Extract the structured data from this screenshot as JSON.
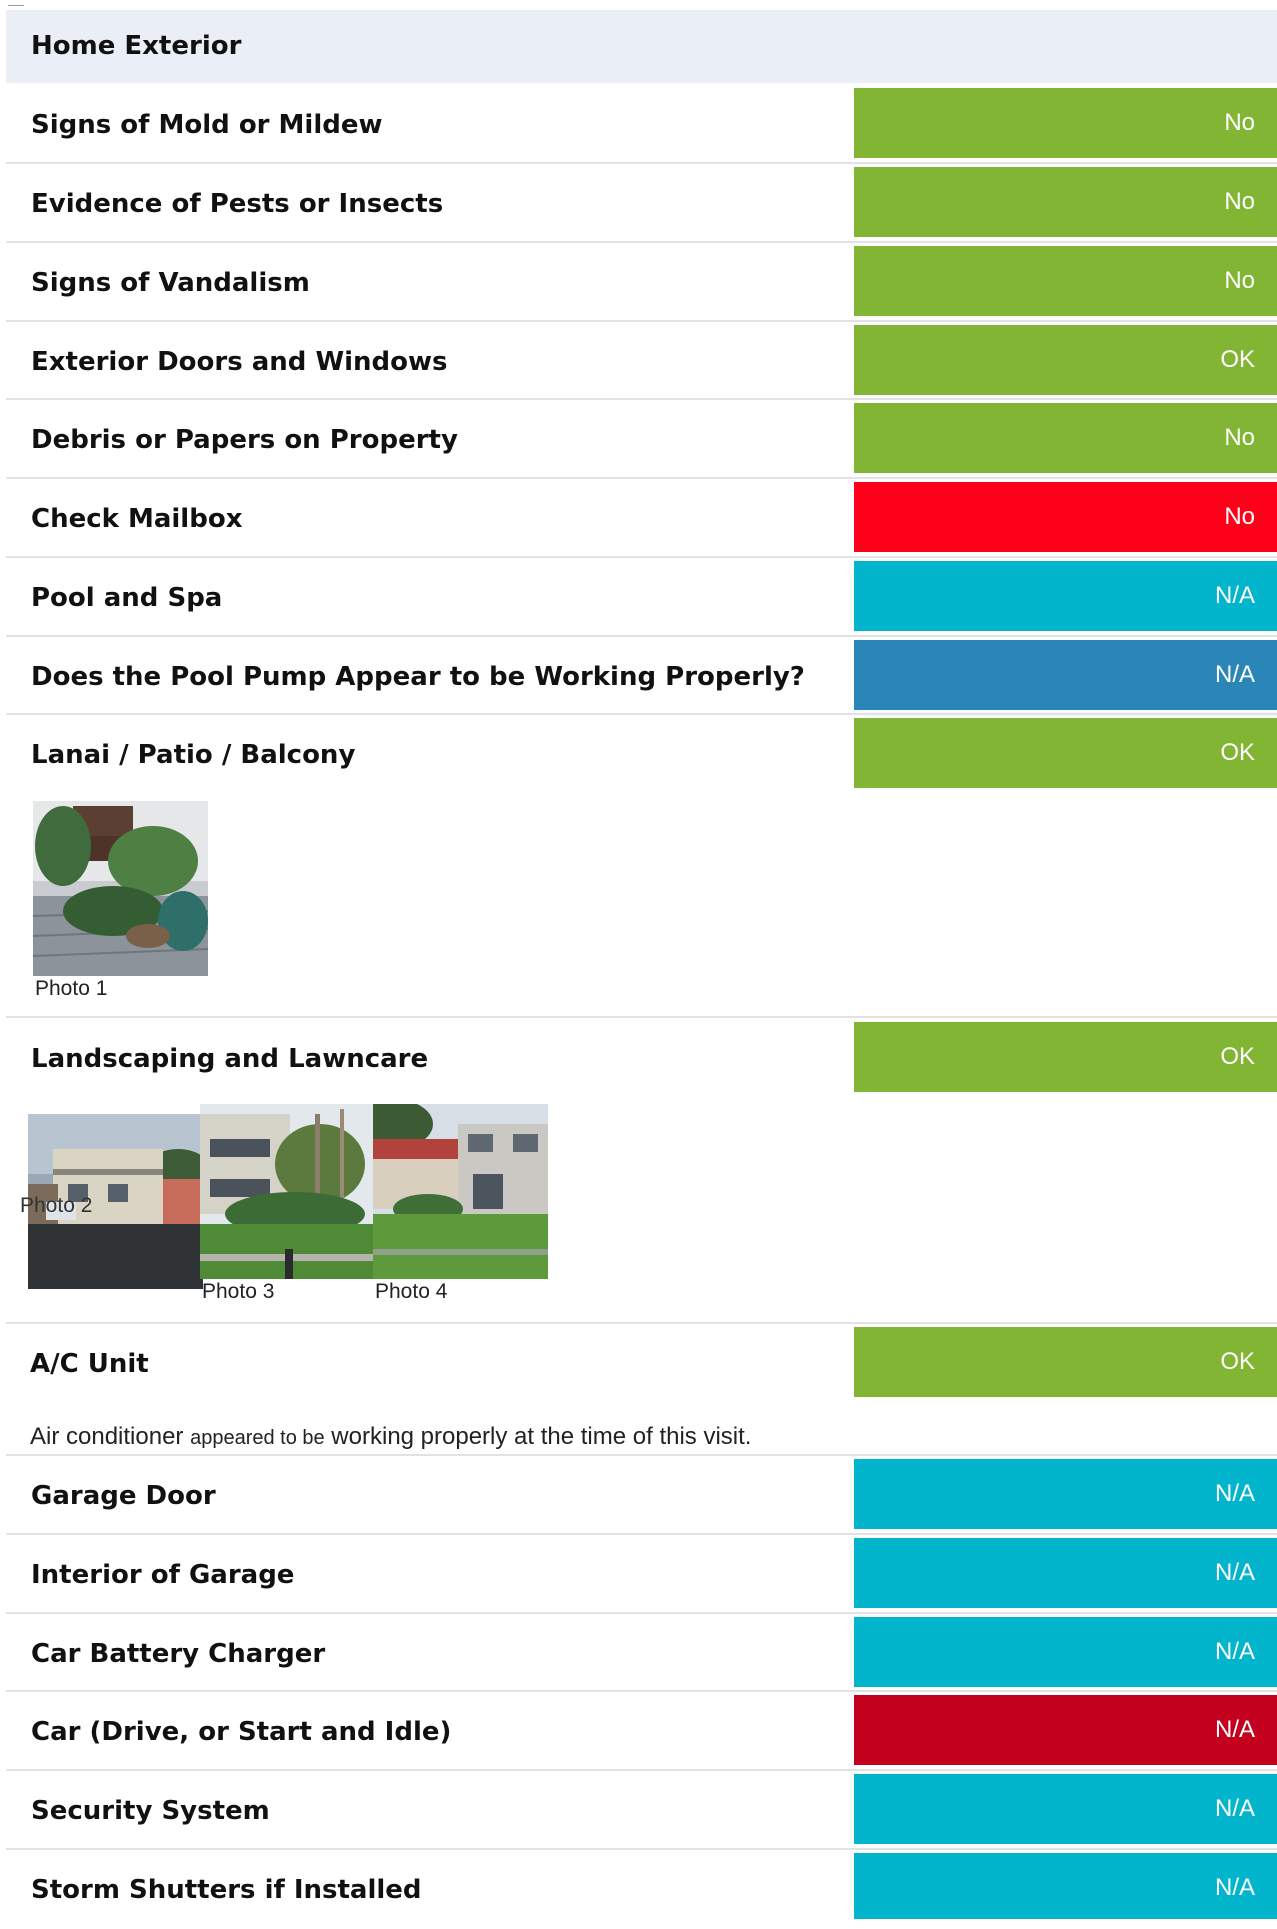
{
  "section": {
    "title": "Home Exterior"
  },
  "items": [
    {
      "label": "Signs of Mold or Mildew",
      "status": "No",
      "color": "#82b533"
    },
    {
      "label": "Evidence of Pests or Insects",
      "status": "No",
      "color": "#82b533"
    },
    {
      "label": "Signs of Vandalism",
      "status": "No",
      "color": "#82b533"
    },
    {
      "label": "Exterior Doors and Windows",
      "status": "OK",
      "color": "#82b533"
    },
    {
      "label": "Debris or Papers on Property",
      "status": "No",
      "color": "#82b533"
    },
    {
      "label": "Check Mailbox",
      "status": "No",
      "color": "#ff001b"
    },
    {
      "label": "Pool and Spa",
      "status": "N/A",
      "color": "#02b5cc"
    },
    {
      "label": "Does the Pool Pump Appear to be Working Properly?",
      "status": "N/A",
      "color": "#2b86b8"
    },
    {
      "label": "Lanai / Patio / Balcony",
      "status": "OK",
      "color": "#82b533",
      "photos": [
        {
          "caption": "Photo 1"
        }
      ]
    },
    {
      "label": "Landscaping and  Lawncare",
      "status": "OK",
      "color": "#82b533",
      "photos": [
        {
          "caption": "Photo 2"
        },
        {
          "caption": "Photo 3"
        },
        {
          "caption": "Photo 4"
        }
      ]
    },
    {
      "label": "A/C Unit",
      "status": "OK",
      "color": "#82b533",
      "note": {
        "part1": "Air conditioner ",
        "part2": "appeared  to  be",
        "part3": " working properly at the time of this visit."
      }
    },
    {
      "label": "Garage Door",
      "status": "N/A",
      "color": "#02b5cc"
    },
    {
      "label": "Interior of Garage",
      "status": "N/A",
      "color": "#02b5cc"
    },
    {
      "label": "Car Battery Charger",
      "status": "N/A",
      "color": "#02b5cc"
    },
    {
      "label": "Car (Drive, or Start and Idle)",
      "status": "N/A",
      "color": "#c4001f"
    },
    {
      "label": "Security System",
      "status": "N/A",
      "color": "#02b5cc"
    },
    {
      "label": "Storm Shutters if Installed",
      "status": "N/A",
      "color": "#02b5cc"
    }
  ]
}
